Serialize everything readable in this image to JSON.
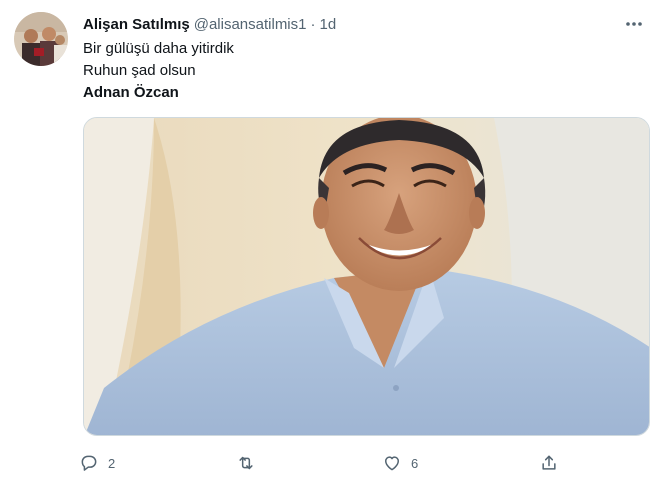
{
  "tweet": {
    "author": {
      "display_name": "Alişan Satılmış",
      "handle": "@alisansatilmis1",
      "separator": "·",
      "timestamp": "1d",
      "avatar_icon": "profile-photo"
    },
    "text_lines": [
      "Bir gülüşü daha yitirdik",
      "Ruhun şad olsun"
    ],
    "text_bold_line": "Adnan Özcan",
    "media": {
      "type": "photo",
      "subject": "smiling man in light blue shirt"
    },
    "actions": {
      "reply": {
        "icon": "reply-icon",
        "count": "2"
      },
      "retweet": {
        "icon": "retweet-icon",
        "count": ""
      },
      "like": {
        "icon": "heart-icon",
        "count": "6"
      },
      "share": {
        "icon": "share-icon"
      }
    },
    "more_icon": "more-options-icon"
  },
  "colors": {
    "text_primary": "#0f1419",
    "text_secondary": "#536471",
    "border": "#cfd9de",
    "background": "#ffffff"
  }
}
